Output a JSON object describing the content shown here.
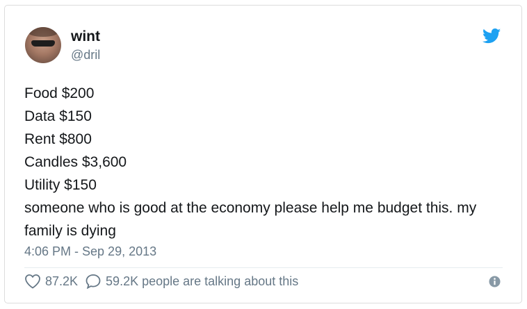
{
  "user": {
    "name": "wint",
    "handle": "@dril"
  },
  "tweet": {
    "lines": [
      "Food $200",
      "Data $150",
      "Rent $800",
      "Candles $3,600",
      "Utility $150",
      "someone who is good at the economy please help me budget this. my family is dying"
    ],
    "timestamp": "4:06 PM - Sep 29, 2013"
  },
  "engagement": {
    "likes": "87.2K",
    "talking": "59.2K people are talking about this"
  },
  "icons": {
    "brand": "twitter-bird-icon",
    "like": "heart-icon",
    "reply": "speech-bubble-icon",
    "info": "info-icon"
  },
  "colors": {
    "brand": "#1da1f2",
    "text": "#14171a",
    "muted": "#657786"
  }
}
